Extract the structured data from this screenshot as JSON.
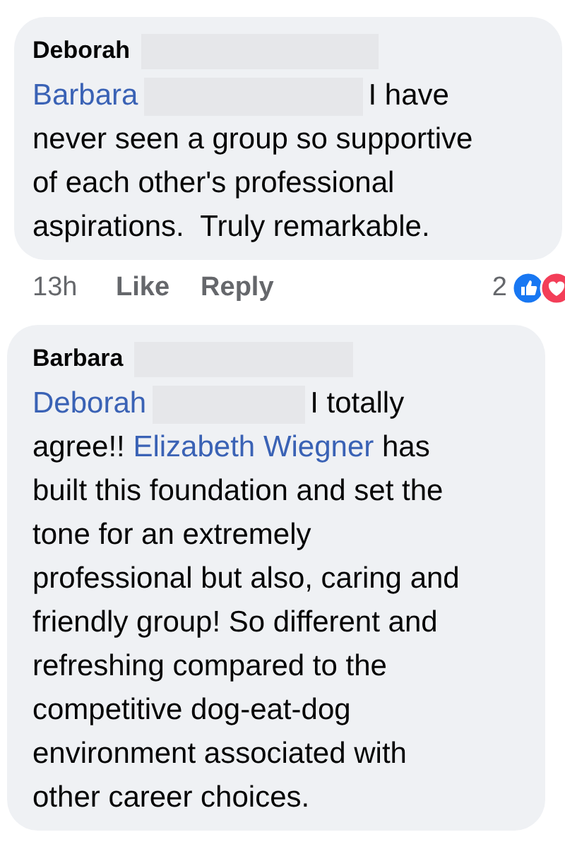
{
  "comments": [
    {
      "author": "Deborah",
      "lines": [
        [
          {
            "kind": "mention",
            "text": "Barbara"
          },
          {
            "kind": "redacted"
          },
          {
            "kind": "text",
            "text": "I have"
          }
        ],
        [
          {
            "kind": "text",
            "text": "never seen a group so supportive"
          }
        ],
        [
          {
            "kind": "text",
            "text": "of each other's professional"
          }
        ],
        [
          {
            "kind": "text",
            "text": "aspirations.  Truly remarkable."
          }
        ]
      ],
      "footer": {
        "time": "13h",
        "like": "Like",
        "reply": "Reply",
        "count": "2",
        "reactions": [
          {
            "kind": "like"
          },
          {
            "kind": "love"
          }
        ]
      }
    },
    {
      "author": "Barbara",
      "lines": [
        [
          {
            "kind": "mention",
            "text": "Deborah"
          },
          {
            "kind": "redacted"
          },
          {
            "kind": "text",
            "text": "I totally"
          }
        ],
        [
          {
            "kind": "text",
            "text": "agree!! "
          },
          {
            "kind": "mention",
            "text": "Elizabeth Wiegner"
          },
          {
            "kind": "text",
            "text": " has"
          }
        ],
        [
          {
            "kind": "text",
            "text": "built this foundation and set the"
          }
        ],
        [
          {
            "kind": "text",
            "text": "tone for an extremely"
          }
        ],
        [
          {
            "kind": "text",
            "text": "professional but also, caring and"
          }
        ],
        [
          {
            "kind": "text",
            "text": "friendly group! So different and"
          }
        ],
        [
          {
            "kind": "text",
            "text": "refreshing compared to the"
          }
        ],
        [
          {
            "kind": "text",
            "text": "competitive dog-eat-dog"
          }
        ],
        [
          {
            "kind": "text",
            "text": "environment associated with"
          }
        ],
        [
          {
            "kind": "text",
            "text": "other career choices."
          }
        ]
      ]
    }
  ]
}
